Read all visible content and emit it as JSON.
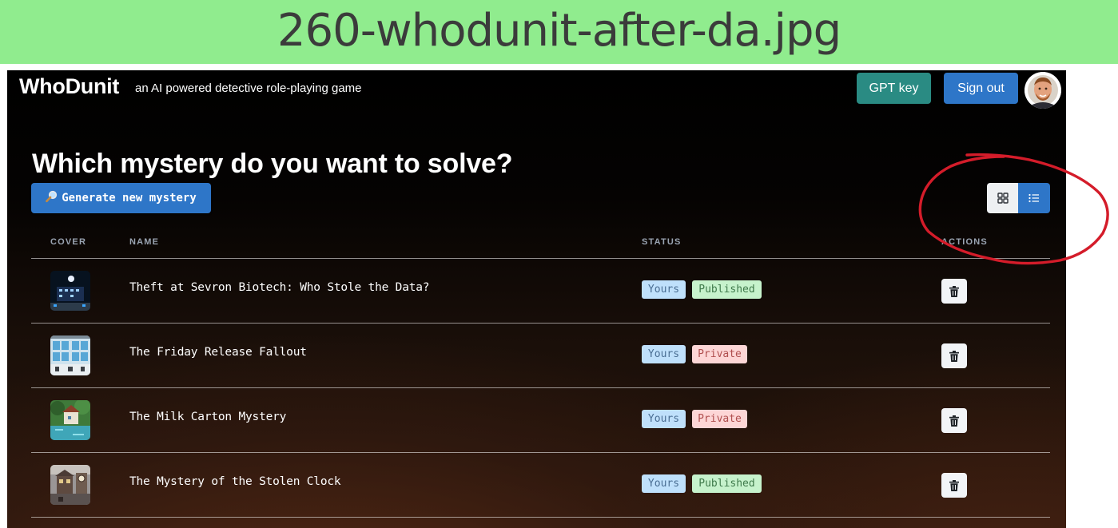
{
  "banner": {
    "filename": "260-whodunit-after-da.jpg"
  },
  "header": {
    "brand": "WhoDunit",
    "tagline": "an AI powered detective role-playing game",
    "gpt_key_label": "GPT key",
    "sign_out_label": "Sign out"
  },
  "main": {
    "heading": "Which mystery do you want to solve?",
    "generate_label": "Generate new mystery",
    "generate_icon": "magnifier-icon",
    "view_toggle": {
      "options": [
        "grid",
        "list"
      ],
      "selected": "list"
    }
  },
  "table": {
    "columns": [
      "COVER",
      "NAME",
      "STATUS",
      "ACTIONS"
    ],
    "rows": [
      {
        "name": "Theft at Sevron Biotech: Who Stole the Data?",
        "owner": "Yours",
        "status": "Published"
      },
      {
        "name": "The Friday Release Fallout",
        "owner": "Yours",
        "status": "Private"
      },
      {
        "name": "The Milk Carton Mystery",
        "owner": "Yours",
        "status": "Private"
      },
      {
        "name": "The Mystery of the Stolen Clock",
        "owner": "Yours",
        "status": "Published"
      }
    ]
  },
  "colors": {
    "primary_blue": "#2e76c8",
    "teal": "#2a8b83",
    "annotation_red": "#d41c2a",
    "banner_green": "#90ec8e"
  }
}
